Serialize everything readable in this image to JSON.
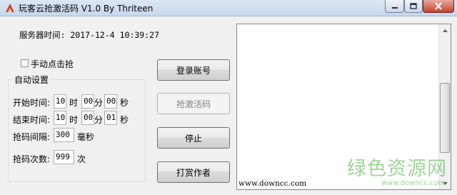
{
  "window": {
    "title": "玩客云抢激活码 V1.0   By Thriteen",
    "min_icon": "minimize-icon",
    "max_icon": "maximize-icon",
    "close_icon": "close-icon"
  },
  "server_time": {
    "label": "服务器时间:",
    "value": "2017-12-4 10:39:27"
  },
  "manual": {
    "label": "手动点击抢",
    "checked": false
  },
  "auto_settings": {
    "title": "自动设置",
    "start": {
      "label": "开始时间:",
      "hour": "10",
      "hour_unit": "时",
      "minute": "00",
      "minute_unit": "分",
      "second": "00",
      "second_unit": "秒"
    },
    "end": {
      "label": "结束时间:",
      "hour": "10",
      "hour_unit": "时",
      "minute": "00",
      "minute_unit": "分",
      "second": "01",
      "second_unit": "秒"
    },
    "interval": {
      "label": "抢码间隔:",
      "value": "300",
      "unit": "毫秒"
    },
    "count": {
      "label": "抢码次数:",
      "value": "999",
      "unit": "次"
    }
  },
  "buttons": {
    "login": "登录账号",
    "grab": "抢激活码",
    "stop": "停止",
    "tip": "打赏作者"
  },
  "log": {
    "text": "www.downcc.com"
  },
  "watermark": {
    "title": "绿色资源网",
    "url": "www.downcc.com"
  }
}
